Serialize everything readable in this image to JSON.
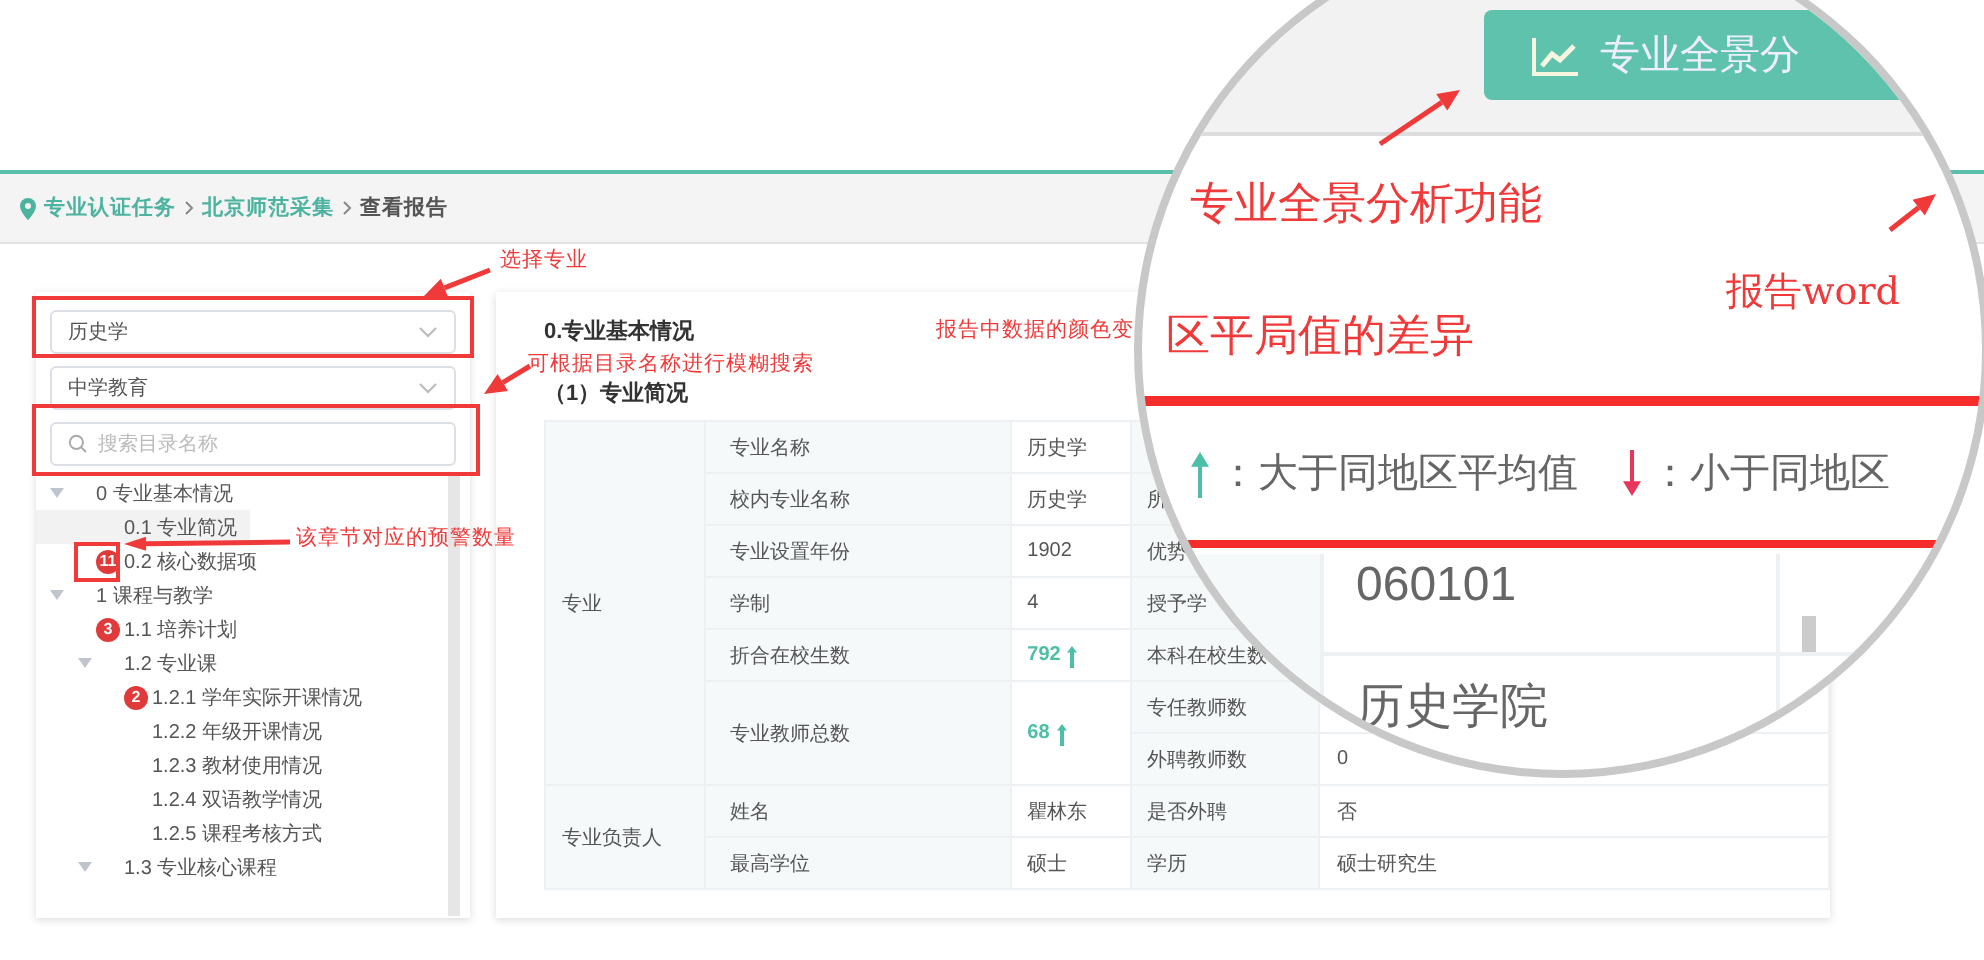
{
  "breadcrumb": [
    {
      "label": "专业认证任务",
      "link": true
    },
    {
      "label": "北京师范采集",
      "link": true
    },
    {
      "label": "查看报告",
      "link": false
    }
  ],
  "sidebar": {
    "major_select": {
      "value": "历史学"
    },
    "category_select": {
      "value": "中学教育"
    },
    "search": {
      "placeholder": "搜索目录名称"
    },
    "tree": [
      {
        "label": "0 专业基本情况",
        "selected": false,
        "expanded": true,
        "children": [
          {
            "label": "0.1 专业简况",
            "selected": true
          },
          {
            "label": "0.2 核心数据项",
            "selected": false,
            "badge": "11"
          }
        ]
      },
      {
        "label": "1 课程与教学",
        "selected": false,
        "expanded": true,
        "children": [
          {
            "label": "1.1 培养计划",
            "selected": false,
            "badge": "3"
          },
          {
            "label": "1.2 专业课",
            "selected": false,
            "expanded": true,
            "children": [
              {
                "label": "1.2.1 学年实际开课情况",
                "selected": false,
                "badge": "2"
              },
              {
                "label": "1.2.2 年级开课情况",
                "selected": false
              },
              {
                "label": "1.2.3 教材使用情况",
                "selected": false
              },
              {
                "label": "1.2.4 双语教学情况",
                "selected": false
              },
              {
                "label": "1.2.5 课程考核方式",
                "selected": false
              }
            ]
          },
          {
            "label": "1.3 专业核心课程",
            "selected": false,
            "expanded": true
          }
        ]
      }
    ]
  },
  "report": {
    "heading": "0.专业基本情况",
    "subheading": "（1）专业简况",
    "sections": [
      {
        "label": "专业",
        "rows": [
          {
            "label": "专业名称",
            "value": "历史学",
            "details": []
          },
          {
            "label": "校内专业名称",
            "value": "历史学",
            "details": [
              {
                "label": "所"
              }
            ]
          },
          {
            "label": "专业设置年份",
            "value": "1902",
            "details": [
              {
                "label": "优势"
              }
            ]
          },
          {
            "label": "学制",
            "value": "4",
            "details": [
              {
                "label": "授予学"
              }
            ]
          },
          {
            "label": "折合在校生数",
            "value": "792",
            "above_average": true,
            "details": [
              {
                "label": "本科在校生数"
              }
            ]
          },
          {
            "label": "专业教师总数",
            "value": "68",
            "above_average": true,
            "details": [
              {
                "label": "专任教师数"
              },
              {
                "label": "外聘教师数",
                "value": "0"
              }
            ]
          }
        ]
      },
      {
        "label": "专业负责人",
        "rows": [
          {
            "label": "姓名",
            "value": "瞿林东",
            "details": [
              {
                "label": "是否外聘",
                "value": "否"
              }
            ]
          },
          {
            "label": "最高学位",
            "value": "硕士",
            "details": [
              {
                "label": "学历",
                "value": "硕士研究生"
              }
            ]
          }
        ]
      }
    ]
  },
  "magnifier": {
    "button": {
      "label": "专业全景分"
    },
    "notes": [
      "专业全景分析功能",
      "报告word",
      "区平局值的差异"
    ],
    "legend": [
      {
        "above_average": true,
        "text": "：大于同地区平均值"
      },
      {
        "above_average": false,
        "text": "：小于同地区"
      }
    ],
    "cells": [
      "060101",
      "历史学院"
    ]
  },
  "annotations": [
    "选择专业",
    "可根据目录名称进行模糊搜索",
    "该章节对应的预警数量",
    "报告中数据的颜色变"
  ]
}
